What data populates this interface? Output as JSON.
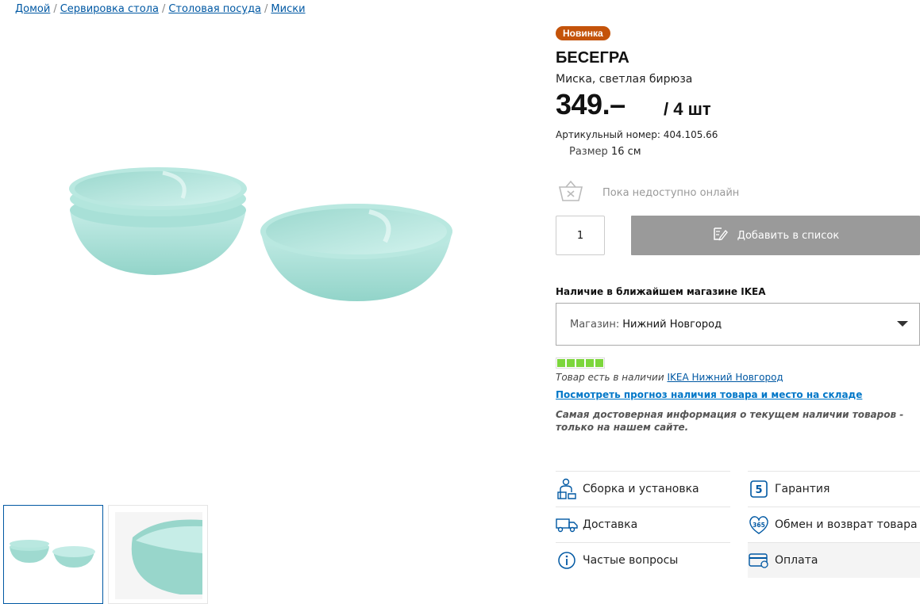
{
  "breadcrumb": [
    "Домой",
    "Сервировка стола",
    "Столовая посуда",
    "Миски"
  ],
  "product": {
    "badge": "Новинка",
    "name": "БЕСЕГРА",
    "description": "Миска, светлая бирюза",
    "price": "349.–",
    "price_unit": "/ 4 шт",
    "article": "Артикульный номер: 404.105.66",
    "size_label": "Размер",
    "size_value": "16 см"
  },
  "availability_online": "Пока недоступно онлайн",
  "cart": {
    "quantity": "1",
    "add_label": "Добавить в список"
  },
  "store": {
    "heading": "Наличие в ближайшем магазине IKEA",
    "select_label": "Магазин:",
    "select_value": "Нижний Новгород",
    "stock_prefix": "Товар есть в наличии",
    "stock_store_link": "IKEA Нижний Новгород",
    "forecast_link": "Посмотреть прогноз наличия товара и место на складе",
    "note": "Самая достоверная информация о текущем наличии товаров - только на нашем сайте."
  },
  "stock_level": 1.0,
  "services": [
    {
      "label": "Сборка и установка",
      "icon": "assembly-icon"
    },
    {
      "label": "Гарантия",
      "icon": "warranty-icon"
    },
    {
      "label": "Доставка",
      "icon": "delivery-truck-icon"
    },
    {
      "label": "Обмен и возврат товара",
      "icon": "return-365-icon"
    },
    {
      "label": "Частые вопросы",
      "icon": "info-icon"
    },
    {
      "label": "Оплата",
      "icon": "credit-card-icon"
    }
  ],
  "warranty_badge": "5",
  "return_badge": "365",
  "colors": {
    "badge": "#c4530a",
    "link": "#0058a3",
    "button_disabled": "#9a9a9a",
    "stock_green": "#7cd63c",
    "bowl": "#a6dfd6"
  }
}
